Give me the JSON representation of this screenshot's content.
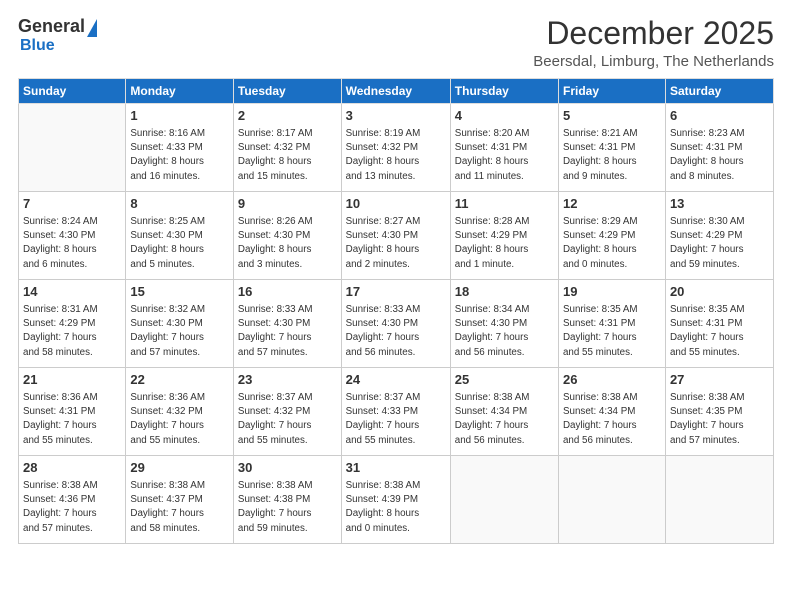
{
  "logo": {
    "general": "General",
    "blue": "Blue"
  },
  "title": "December 2025",
  "subtitle": "Beersdal, Limburg, The Netherlands",
  "days": [
    "Sunday",
    "Monday",
    "Tuesday",
    "Wednesday",
    "Thursday",
    "Friday",
    "Saturday"
  ],
  "weeks": [
    [
      {
        "num": "",
        "text": ""
      },
      {
        "num": "1",
        "text": "Sunrise: 8:16 AM\nSunset: 4:33 PM\nDaylight: 8 hours\nand 16 minutes."
      },
      {
        "num": "2",
        "text": "Sunrise: 8:17 AM\nSunset: 4:32 PM\nDaylight: 8 hours\nand 15 minutes."
      },
      {
        "num": "3",
        "text": "Sunrise: 8:19 AM\nSunset: 4:32 PM\nDaylight: 8 hours\nand 13 minutes."
      },
      {
        "num": "4",
        "text": "Sunrise: 8:20 AM\nSunset: 4:31 PM\nDaylight: 8 hours\nand 11 minutes."
      },
      {
        "num": "5",
        "text": "Sunrise: 8:21 AM\nSunset: 4:31 PM\nDaylight: 8 hours\nand 9 minutes."
      },
      {
        "num": "6",
        "text": "Sunrise: 8:23 AM\nSunset: 4:31 PM\nDaylight: 8 hours\nand 8 minutes."
      }
    ],
    [
      {
        "num": "7",
        "text": "Sunrise: 8:24 AM\nSunset: 4:30 PM\nDaylight: 8 hours\nand 6 minutes."
      },
      {
        "num": "8",
        "text": "Sunrise: 8:25 AM\nSunset: 4:30 PM\nDaylight: 8 hours\nand 5 minutes."
      },
      {
        "num": "9",
        "text": "Sunrise: 8:26 AM\nSunset: 4:30 PM\nDaylight: 8 hours\nand 3 minutes."
      },
      {
        "num": "10",
        "text": "Sunrise: 8:27 AM\nSunset: 4:30 PM\nDaylight: 8 hours\nand 2 minutes."
      },
      {
        "num": "11",
        "text": "Sunrise: 8:28 AM\nSunset: 4:29 PM\nDaylight: 8 hours\nand 1 minute."
      },
      {
        "num": "12",
        "text": "Sunrise: 8:29 AM\nSunset: 4:29 PM\nDaylight: 8 hours\nand 0 minutes."
      },
      {
        "num": "13",
        "text": "Sunrise: 8:30 AM\nSunset: 4:29 PM\nDaylight: 7 hours\nand 59 minutes."
      }
    ],
    [
      {
        "num": "14",
        "text": "Sunrise: 8:31 AM\nSunset: 4:29 PM\nDaylight: 7 hours\nand 58 minutes."
      },
      {
        "num": "15",
        "text": "Sunrise: 8:32 AM\nSunset: 4:30 PM\nDaylight: 7 hours\nand 57 minutes."
      },
      {
        "num": "16",
        "text": "Sunrise: 8:33 AM\nSunset: 4:30 PM\nDaylight: 7 hours\nand 57 minutes."
      },
      {
        "num": "17",
        "text": "Sunrise: 8:33 AM\nSunset: 4:30 PM\nDaylight: 7 hours\nand 56 minutes."
      },
      {
        "num": "18",
        "text": "Sunrise: 8:34 AM\nSunset: 4:30 PM\nDaylight: 7 hours\nand 56 minutes."
      },
      {
        "num": "19",
        "text": "Sunrise: 8:35 AM\nSunset: 4:31 PM\nDaylight: 7 hours\nand 55 minutes."
      },
      {
        "num": "20",
        "text": "Sunrise: 8:35 AM\nSunset: 4:31 PM\nDaylight: 7 hours\nand 55 minutes."
      }
    ],
    [
      {
        "num": "21",
        "text": "Sunrise: 8:36 AM\nSunset: 4:31 PM\nDaylight: 7 hours\nand 55 minutes."
      },
      {
        "num": "22",
        "text": "Sunrise: 8:36 AM\nSunset: 4:32 PM\nDaylight: 7 hours\nand 55 minutes."
      },
      {
        "num": "23",
        "text": "Sunrise: 8:37 AM\nSunset: 4:32 PM\nDaylight: 7 hours\nand 55 minutes."
      },
      {
        "num": "24",
        "text": "Sunrise: 8:37 AM\nSunset: 4:33 PM\nDaylight: 7 hours\nand 55 minutes."
      },
      {
        "num": "25",
        "text": "Sunrise: 8:38 AM\nSunset: 4:34 PM\nDaylight: 7 hours\nand 56 minutes."
      },
      {
        "num": "26",
        "text": "Sunrise: 8:38 AM\nSunset: 4:34 PM\nDaylight: 7 hours\nand 56 minutes."
      },
      {
        "num": "27",
        "text": "Sunrise: 8:38 AM\nSunset: 4:35 PM\nDaylight: 7 hours\nand 57 minutes."
      }
    ],
    [
      {
        "num": "28",
        "text": "Sunrise: 8:38 AM\nSunset: 4:36 PM\nDaylight: 7 hours\nand 57 minutes."
      },
      {
        "num": "29",
        "text": "Sunrise: 8:38 AM\nSunset: 4:37 PM\nDaylight: 7 hours\nand 58 minutes."
      },
      {
        "num": "30",
        "text": "Sunrise: 8:38 AM\nSunset: 4:38 PM\nDaylight: 7 hours\nand 59 minutes."
      },
      {
        "num": "31",
        "text": "Sunrise: 8:38 AM\nSunset: 4:39 PM\nDaylight: 8 hours\nand 0 minutes."
      },
      {
        "num": "",
        "text": ""
      },
      {
        "num": "",
        "text": ""
      },
      {
        "num": "",
        "text": ""
      }
    ]
  ]
}
